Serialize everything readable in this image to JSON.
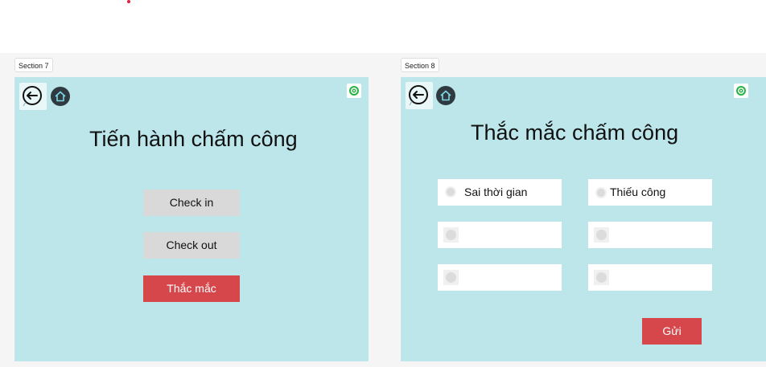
{
  "section7": {
    "label": "Section 7",
    "title": "Tiến hành chấm công",
    "buttons": {
      "check_in": "Check in",
      "check_out": "Check out",
      "question": "Thắc mắc"
    }
  },
  "section8": {
    "label": "Section 8",
    "title": "Thắc mắc chấm công",
    "options": [
      {
        "label": "Sai thời gian"
      },
      {
        "label": "Thiếu công"
      },
      {
        "label": ""
      },
      {
        "label": ""
      },
      {
        "label": ""
      },
      {
        "label": ""
      }
    ],
    "send_label": "Gửi"
  },
  "icons": {
    "back": "back-arrow-icon",
    "home": "home-icon",
    "settings": "gear-icon"
  },
  "colors": {
    "frame_bg": "#bce6ea",
    "primary": "#d6474b",
    "secondary_button": "#d9d9d9",
    "canvas_bg": "#f5f5f5"
  }
}
